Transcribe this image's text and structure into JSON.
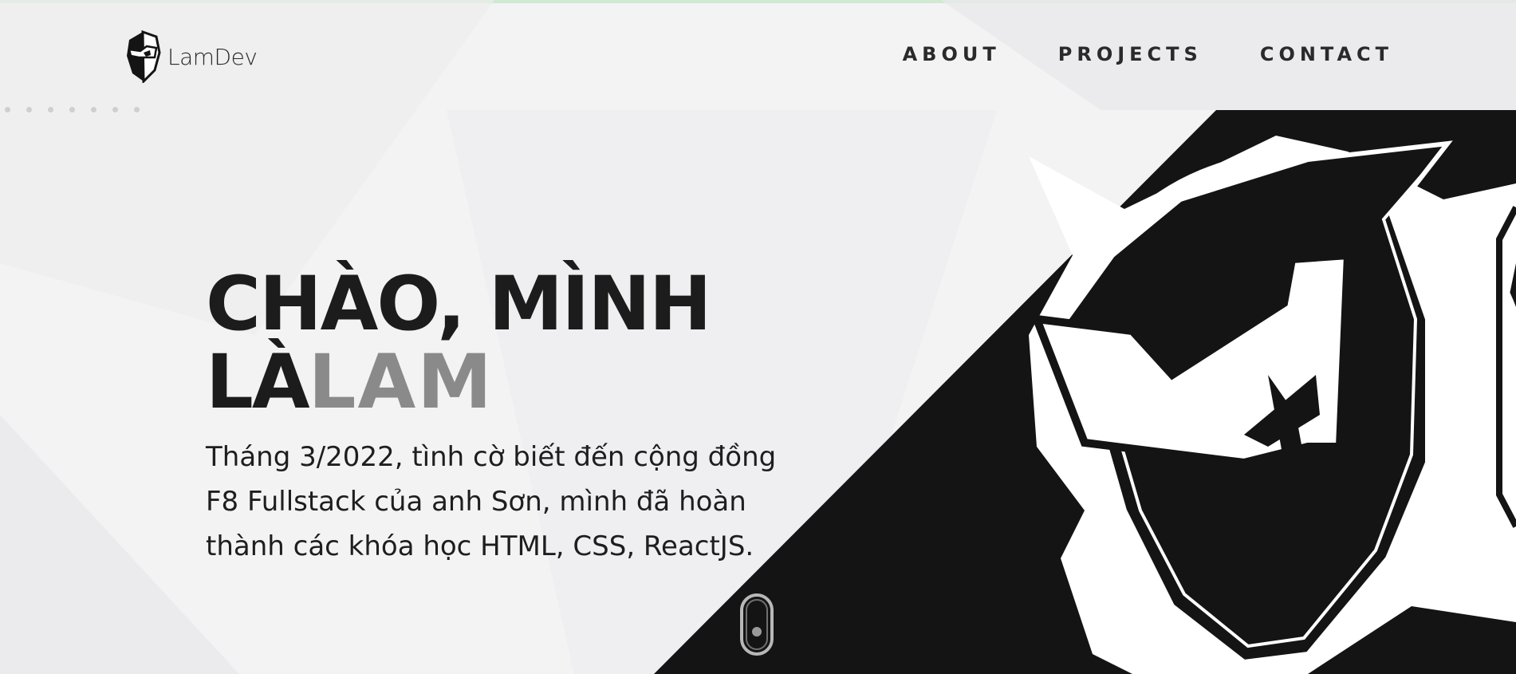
{
  "header": {
    "logo_text": "LamDev",
    "nav": {
      "about": "ABOUT",
      "projects": "PROJECTS",
      "contact": "CONTACT"
    }
  },
  "hero": {
    "headline_line1": "CHÀO, MÌNH",
    "headline_prefix": "LÀ",
    "headline_name": "LAM",
    "intro": "Tháng 3/2022, tình cờ biết đến cộng đồng F8 Fullstack của anh Sơn, mình đã hoàn thành các khóa học HTML, CSS, ReactJS."
  },
  "icons": {
    "logo": "masked-face-logo-icon",
    "hero_art": "masked-face-emblem",
    "scroll": "mouse-scroll-icon"
  },
  "colors": {
    "accent_strip": "#cfe9d3",
    "background": "#f3f3f4",
    "text_dark": "#1c1c1c",
    "name_gray": "#8a8a8a",
    "art_black": "#141414"
  }
}
